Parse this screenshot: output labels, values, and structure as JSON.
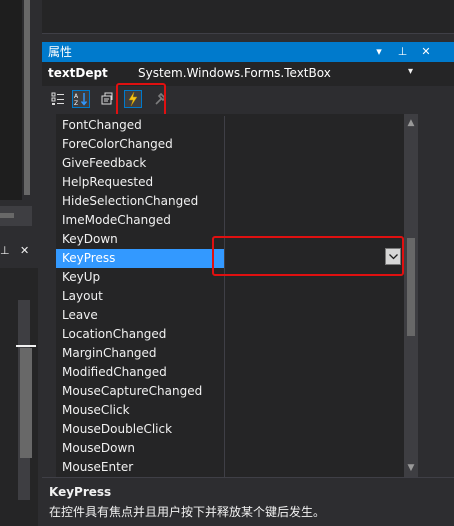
{
  "panel": {
    "title": "属性",
    "controls": {
      "dropdown": "▾",
      "pin": "⊥",
      "close": "✕"
    }
  },
  "object_selector": {
    "name": "textDept",
    "type": "System.Windows.Forms.TextBox",
    "dropdown": "▾"
  },
  "toolbar": {
    "icons": [
      "categorized-icon",
      "alphabetical-icon",
      "properties-icon",
      "events-icon",
      "property-pages-icon"
    ],
    "active": "events-icon"
  },
  "events": [
    {
      "name": "FontChanged",
      "value": ""
    },
    {
      "name": "ForeColorChanged",
      "value": ""
    },
    {
      "name": "GiveFeedback",
      "value": ""
    },
    {
      "name": "HelpRequested",
      "value": ""
    },
    {
      "name": "HideSelectionChanged",
      "value": ""
    },
    {
      "name": "ImeModeChanged",
      "value": ""
    },
    {
      "name": "KeyDown",
      "value": ""
    },
    {
      "name": "KeyPress",
      "value": "",
      "selected": true
    },
    {
      "name": "KeyUp",
      "value": ""
    },
    {
      "name": "Layout",
      "value": ""
    },
    {
      "name": "Leave",
      "value": ""
    },
    {
      "name": "LocationChanged",
      "value": ""
    },
    {
      "name": "MarginChanged",
      "value": ""
    },
    {
      "name": "ModifiedChanged",
      "value": ""
    },
    {
      "name": "MouseCaptureChanged",
      "value": ""
    },
    {
      "name": "MouseClick",
      "value": ""
    },
    {
      "name": "MouseDoubleClick",
      "value": ""
    },
    {
      "name": "MouseDown",
      "value": ""
    },
    {
      "name": "MouseEnter",
      "value": ""
    }
  ],
  "scrollbar": {
    "up": "▲",
    "down": "▼"
  },
  "description": {
    "title": "KeyPress",
    "text": "在控件具有焦点并且用户按下并释放某个键后发生。"
  },
  "left_panel": {
    "pin": "⊥",
    "close": "✕"
  },
  "colors": {
    "accent": "#007acc",
    "selection": "#3399ff",
    "highlight_annotation": "#e01010",
    "background": "#2d2d30"
  }
}
